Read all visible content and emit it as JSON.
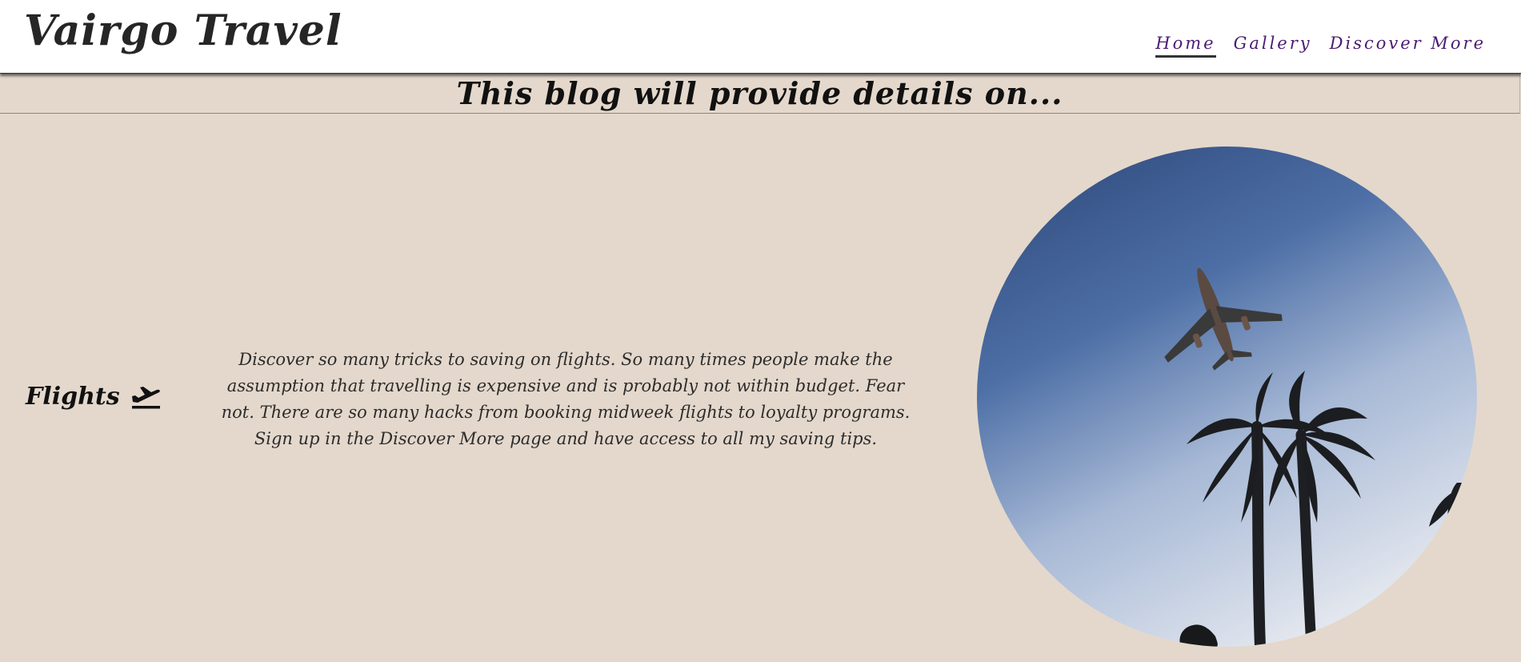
{
  "header": {
    "title": "Vairgo Travel",
    "nav": [
      {
        "label": "Home",
        "active": true
      },
      {
        "label": "Gallery",
        "active": false
      },
      {
        "label": "Discover More",
        "active": false
      }
    ]
  },
  "banner": {
    "heading": "This blog will provide details on..."
  },
  "feature": {
    "label": "Flights",
    "icon": "plane-departure-icon",
    "description": "Discover so many tricks to saving on flights. So many times people make the assumption that travelling is expensive and is probably not within budget. Fear not. There are so many hacks from booking midweek flights to loyalty programs. Sign up in the Discover More page and have access to all my saving tips.",
    "image": "airplane-over-palm-trees-photo"
  },
  "colors": {
    "background": "#e4d8cc",
    "header": "#ffffff",
    "nav_link": "#4b1b72",
    "sky_top": "#2f4a7c",
    "sky_bottom": "#dfe4ec"
  }
}
